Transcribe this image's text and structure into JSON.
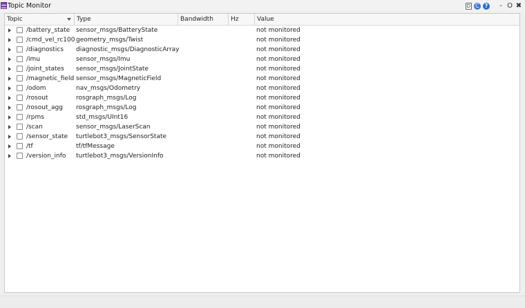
{
  "window": {
    "title": "Topic Monitor",
    "icons": [
      "dock-icon",
      "refresh-icon",
      "help-icon",
      "minimize-icon",
      "restore-icon",
      "close-icon"
    ],
    "help_glyph": "?",
    "d_glyph": "D",
    "refresh_glyph": "C",
    "minimize_glyph": "-",
    "restore_glyph": "O",
    "close_glyph": "✖"
  },
  "columns": {
    "topic": "Topic",
    "type": "Type",
    "bandwidth": "Bandwidth",
    "hz": "Hz",
    "value": "Value"
  },
  "rows": [
    {
      "topic": "/battery_state",
      "type": "sensor_msgs/BatteryState",
      "value": "not monitored"
    },
    {
      "topic": "/cmd_vel_rc100",
      "type": "geometry_msgs/Twist",
      "value": "not monitored"
    },
    {
      "topic": "/diagnostics",
      "type": "diagnostic_msgs/DiagnosticArray",
      "value": "not monitored"
    },
    {
      "topic": "/imu",
      "type": "sensor_msgs/Imu",
      "value": "not monitored"
    },
    {
      "topic": "/joint_states",
      "type": "sensor_msgs/JointState",
      "value": "not monitored"
    },
    {
      "topic": "/magnetic_field",
      "type": "sensor_msgs/MagneticField",
      "value": "not monitored"
    },
    {
      "topic": "/odom",
      "type": "nav_msgs/Odometry",
      "value": "not monitored"
    },
    {
      "topic": "/rosout",
      "type": "rosgraph_msgs/Log",
      "value": "not monitored"
    },
    {
      "topic": "/rosout_agg",
      "type": "rosgraph_msgs/Log",
      "value": "not monitored"
    },
    {
      "topic": "/rpms",
      "type": "std_msgs/UInt16",
      "value": "not monitored"
    },
    {
      "topic": "/scan",
      "type": "sensor_msgs/LaserScan",
      "value": "not monitored"
    },
    {
      "topic": "/sensor_state",
      "type": "turtlebot3_msgs/SensorState",
      "value": "not monitored"
    },
    {
      "topic": "/tf",
      "type": "tf/tfMessage",
      "value": "not monitored"
    },
    {
      "topic": "/version_info",
      "type": "turtlebot3_msgs/VersionInfo",
      "value": "not monitored"
    }
  ]
}
